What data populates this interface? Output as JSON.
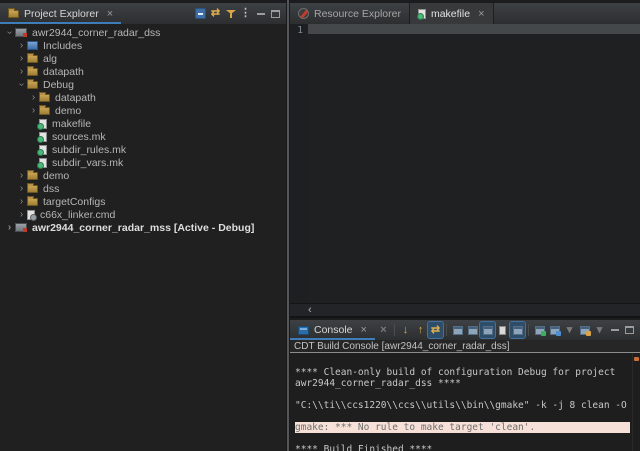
{
  "app": {
    "accent_color": "#3f7cba",
    "error_highlight_color": "#f7e0d7"
  },
  "left_panel": {
    "tab_label": "Project Explorer",
    "close_label": "×",
    "toolbar": [
      {
        "name": "collapse-all-icon",
        "type": "collapse"
      },
      {
        "name": "link-with-editor-icon",
        "glyph": "⇄",
        "style": "yellow"
      },
      {
        "name": "filter-icon",
        "type": "funnel"
      },
      {
        "name": "view-menu-icon",
        "glyph": "⋮",
        "style": "light"
      },
      {
        "name": "minimize-icon",
        "type": "min"
      },
      {
        "name": "maximize-icon",
        "type": "max"
      }
    ],
    "tree": [
      {
        "label": "awr2944_corner_radar_dss",
        "level": 0,
        "chevron": "expanded",
        "icon": "project"
      },
      {
        "label": "Includes",
        "level": 1,
        "chevron": "collapsed",
        "icon": "includes"
      },
      {
        "label": "alg",
        "level": 1,
        "chevron": "collapsed",
        "icon": "folder"
      },
      {
        "label": "datapath",
        "level": 1,
        "chevron": "collapsed",
        "icon": "folder"
      },
      {
        "label": "Debug",
        "level": 1,
        "chevron": "expanded",
        "icon": "folder"
      },
      {
        "label": "datapath",
        "level": 2,
        "chevron": "collapsed",
        "icon": "folder"
      },
      {
        "label": "demo",
        "level": 2,
        "chevron": "collapsed",
        "icon": "folder"
      },
      {
        "label": "makefile",
        "level": 2,
        "chevron": "none",
        "icon": "file"
      },
      {
        "label": "sources.mk",
        "level": 2,
        "chevron": "none",
        "icon": "file"
      },
      {
        "label": "subdir_rules.mk",
        "level": 2,
        "chevron": "none",
        "icon": "file"
      },
      {
        "label": "subdir_vars.mk",
        "level": 2,
        "chevron": "none",
        "icon": "file"
      },
      {
        "label": "demo",
        "level": 1,
        "chevron": "collapsed",
        "icon": "folder"
      },
      {
        "label": "dss",
        "level": 1,
        "chevron": "collapsed",
        "icon": "folder"
      },
      {
        "label": "targetConfigs",
        "level": 1,
        "chevron": "collapsed",
        "icon": "folder"
      },
      {
        "label": "c66x_linker.cmd",
        "level": 1,
        "chevron": "collapsed",
        "icon": "cmdfile"
      },
      {
        "label": "awr2944_corner_radar_mss",
        "level": 0,
        "chevron": "collapsed",
        "icon": "project",
        "bold": true,
        "suffix": "  [Active - Debug]"
      }
    ]
  },
  "editor": {
    "tabs": [
      {
        "label": "Resource Explorer",
        "active": false
      },
      {
        "label": "makefile",
        "active": true,
        "close_label": "×"
      }
    ],
    "line_number": "1",
    "scroll_left_arrow": "‹"
  },
  "console": {
    "tab_label": "Console",
    "close_label": "×",
    "title": "CDT Build Console [awr2944_corner_radar_dss]",
    "toolbar": [
      {
        "name": "clear-console-icon",
        "glyph": "×",
        "style": "dim"
      },
      {
        "type": "sep"
      },
      {
        "name": "next-error-icon",
        "glyph": "↓",
        "style": "yellow"
      },
      {
        "name": "previous-error-icon",
        "glyph": "↑",
        "style": "yellow"
      },
      {
        "name": "show-error-in-editor-icon",
        "glyph": "⇄",
        "style": "yellow",
        "active": true
      },
      {
        "type": "sep"
      },
      {
        "name": "show-stdout-console-icon",
        "type": "win"
      },
      {
        "name": "show-stderr-console-icon",
        "type": "win"
      },
      {
        "name": "word-wrap-icon",
        "type": "win",
        "active": true
      },
      {
        "name": "scroll-lock-icon",
        "type": "page"
      },
      {
        "name": "pin-console-icon",
        "type": "win",
        "active": true
      },
      {
        "type": "sep"
      },
      {
        "name": "display-selected-console-icon",
        "type": "win",
        "badge": "green"
      },
      {
        "name": "open-console-icon",
        "type": "win",
        "badge": "blue"
      },
      {
        "name": "open-console-dropdown-icon",
        "glyph": "▾",
        "style": "dim"
      },
      {
        "name": "new-console-view-icon",
        "type": "win",
        "badge": "yellow"
      },
      {
        "name": "new-console-dropdown-icon",
        "glyph": "▾",
        "style": "dim"
      },
      {
        "name": "minimize-icon",
        "type": "min"
      },
      {
        "name": "maximize-icon",
        "type": "max"
      }
    ],
    "lines": [
      {
        "text": ""
      },
      {
        "text": "**** Clean-only build of configuration Debug for project"
      },
      {
        "text": "awr2944_corner_radar_dss ****"
      },
      {
        "text": ""
      },
      {
        "text": "\"C:\\\\ti\\\\ccs1220\\\\ccs\\\\utils\\\\bin\\\\gmake\" -k -j 8 clean -O"
      },
      {
        "text": ""
      },
      {
        "text": "gmake: *** No rule to make target 'clean'.",
        "highlight": true
      },
      {
        "text": ""
      },
      {
        "text": "**** Build Finished ****"
      }
    ]
  }
}
